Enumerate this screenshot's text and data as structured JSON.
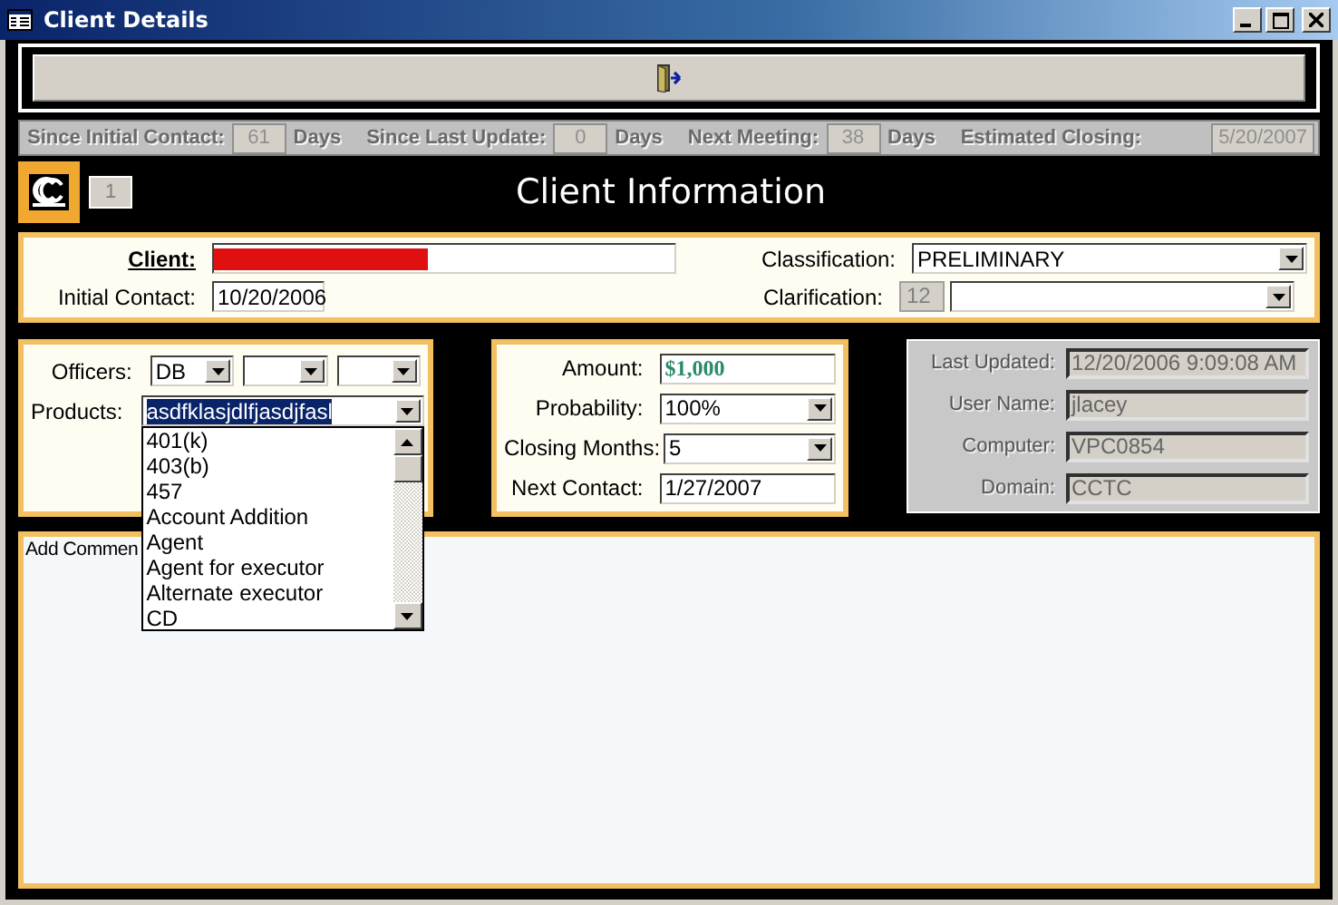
{
  "window": {
    "title": "Client Details"
  },
  "stats": [
    {
      "label": "Since Initial Contact:",
      "value": "61",
      "unit": "Days"
    },
    {
      "label": "Since Last Update:",
      "value": "0",
      "unit": "Days"
    },
    {
      "label": "Next Meeting:",
      "value": "38",
      "unit": "Days"
    },
    {
      "label": "Estimated Closing:",
      "value": "5/20/2007"
    }
  ],
  "header": {
    "record": "1",
    "title": "Client Information"
  },
  "client": {
    "label": "Client:",
    "redacted": true
  },
  "classification": {
    "label": "Classification:",
    "value": "PRELIMINARY"
  },
  "initial_contact": {
    "label": "Initial Contact:",
    "value": "10/20/2006"
  },
  "clarification": {
    "label": "Clarification:",
    "code": "12"
  },
  "officers": {
    "label": "Officers:",
    "combos": [
      {
        "kind": "filled",
        "value": "DB"
      },
      {
        "kind": "empty"
      },
      {
        "kind": "empty"
      }
    ]
  },
  "products": {
    "label": "Products:",
    "value": "asdfklasjdlfjasdjfasl",
    "selected": true,
    "expanded": true,
    "options": [
      "401(k)",
      "403(b)",
      "457",
      "Account Addition",
      "Agent",
      "Agent for executor",
      "Alternate executor",
      "CD"
    ]
  },
  "deal": [
    {
      "kind": "amount",
      "label": "Amount:",
      "value": "$1,000"
    },
    {
      "kind": "combo",
      "label": "Probability:",
      "value": "100%"
    },
    {
      "kind": "combo",
      "label": "Closing Months:",
      "value": "5"
    },
    {
      "kind": "text",
      "label": "Next Contact:",
      "value": "1/27/2007"
    }
  ],
  "audit": {
    "disabled": true,
    "fields": [
      {
        "label": "Last Updated:",
        "value": "12/20/2006 9:09:08 AM"
      },
      {
        "label": "User Name:",
        "value": "jlacey"
      },
      {
        "label": "Computer:",
        "value": "VPC0854"
      },
      {
        "label": "Domain:",
        "value": "CCTC"
      }
    ]
  },
  "comments": {
    "label": "Add Commen"
  }
}
